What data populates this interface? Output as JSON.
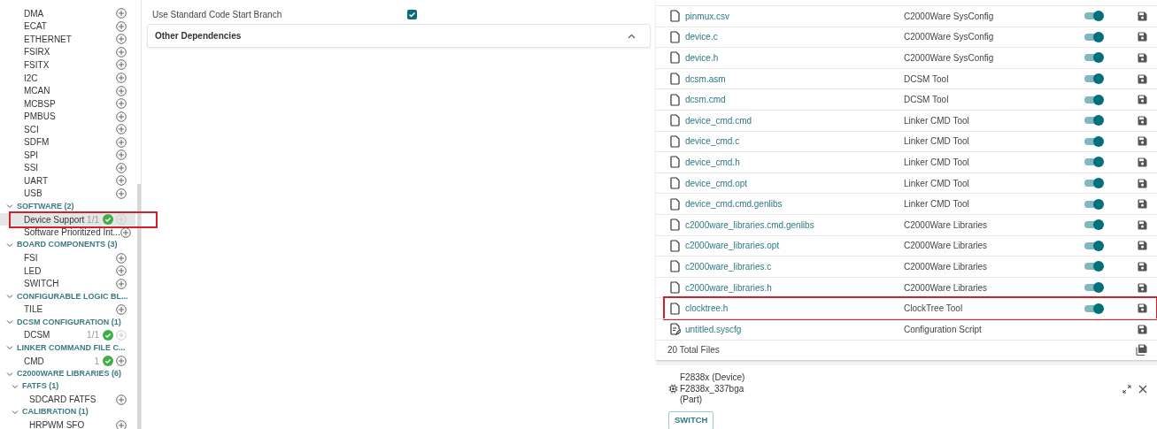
{
  "sidebar": {
    "tree": [
      {
        "label": "DMA",
        "selected": false,
        "add_disabled": false
      },
      {
        "label": "ECAT",
        "selected": false,
        "add_disabled": false
      },
      {
        "label": "ETHERNET",
        "selected": false,
        "add_disabled": false
      },
      {
        "label": "FSIRX",
        "selected": false,
        "add_disabled": false
      },
      {
        "label": "FSITX",
        "selected": false,
        "add_disabled": false
      },
      {
        "label": "I2C",
        "selected": false,
        "add_disabled": false
      },
      {
        "label": "MCAN",
        "selected": false,
        "add_disabled": false
      },
      {
        "label": "MCBSP",
        "selected": false,
        "add_disabled": false
      },
      {
        "label": "PMBUS",
        "selected": false,
        "add_disabled": false
      },
      {
        "label": "SCI",
        "selected": false,
        "add_disabled": false
      },
      {
        "label": "SDFM",
        "selected": false,
        "add_disabled": false
      },
      {
        "label": "SPI",
        "selected": false,
        "add_disabled": false
      },
      {
        "label": "SSI",
        "selected": false,
        "add_disabled": false
      },
      {
        "label": "UART",
        "selected": false,
        "add_disabled": false
      },
      {
        "label": "USB",
        "selected": false,
        "add_disabled": false
      },
      {
        "label": "SOFTWARE (2)",
        "expanded": true,
        "children": [
          {
            "label": "Device Support",
            "count": "1/1",
            "configured": true,
            "selected": true,
            "add_disabled": true,
            "annotated": true
          },
          {
            "label": "Software Prioritized Int...",
            "selected": false,
            "add_disabled": false
          }
        ]
      },
      {
        "label": "BOARD COMPONENTS (3)",
        "expanded": true,
        "children": [
          {
            "label": "FSI",
            "selected": false,
            "add_disabled": false
          },
          {
            "label": "LED",
            "selected": false,
            "add_disabled": false
          },
          {
            "label": "SWITCH",
            "selected": false,
            "add_disabled": false
          }
        ]
      },
      {
        "label": "CONFIGURABLE LOGIC BL...",
        "expanded": true,
        "children": [
          {
            "label": "TILE",
            "selected": false,
            "add_disabled": false
          }
        ]
      },
      {
        "label": "DCSM CONFIGURATION (1)",
        "expanded": true,
        "children": [
          {
            "label": "DCSM",
            "count": "1/1",
            "configured": true,
            "selected": false,
            "add_disabled": true
          }
        ]
      },
      {
        "label": "LINKER COMMAND FILE C...",
        "expanded": true,
        "children": [
          {
            "label": "CMD",
            "count": "1",
            "configured": true,
            "selected": false,
            "add_disabled": false
          }
        ]
      },
      {
        "label": "C2000WARE LIBRARIES (6)",
        "expanded": true,
        "children": [
          {
            "label": "FATFS (1)",
            "expanded": true,
            "children": [
              {
                "label": "SDCARD FATFS",
                "selected": false,
                "add_disabled": false
              }
            ]
          },
          {
            "label": "CALIBRATION (1)",
            "expanded": true,
            "children": [
              {
                "label": "HRPWM SFO",
                "selected": false,
                "add_disabled": false
              }
            ]
          }
        ]
      }
    ]
  },
  "settings": {
    "rows": [
      {
        "label": "Use Standard Code Start Branch",
        "checked": true
      }
    ],
    "sections": [
      {
        "title": "Other Dependencies",
        "expanded": true
      }
    ]
  },
  "files": {
    "rows": [
      {
        "kind": "file",
        "name": "pinmux.csv",
        "source": "C2000Ware SysConfig",
        "on": true
      },
      {
        "kind": "file",
        "name": "device.c",
        "source": "C2000Ware SysConfig",
        "on": true
      },
      {
        "kind": "file",
        "name": "device.h",
        "source": "C2000Ware SysConfig",
        "on": true
      },
      {
        "kind": "file",
        "name": "dcsm.asm",
        "source": "DCSM Tool",
        "on": true
      },
      {
        "kind": "file",
        "name": "dcsm.cmd",
        "source": "DCSM Tool",
        "on": true
      },
      {
        "kind": "file",
        "name": "device_cmd.cmd",
        "source": "Linker CMD Tool",
        "on": true
      },
      {
        "kind": "file",
        "name": "device_cmd.c",
        "source": "Linker CMD Tool",
        "on": true
      },
      {
        "kind": "file",
        "name": "device_cmd.h",
        "source": "Linker CMD Tool",
        "on": true
      },
      {
        "kind": "file",
        "name": "device_cmd.opt",
        "source": "Linker CMD Tool",
        "on": true
      },
      {
        "kind": "file",
        "name": "device_cmd.cmd.genlibs",
        "source": "Linker CMD Tool",
        "on": true
      },
      {
        "kind": "file",
        "name": "c2000ware_libraries.cmd.genlibs",
        "source": "C2000Ware Libraries",
        "on": true
      },
      {
        "kind": "file",
        "name": "c2000ware_libraries.opt",
        "source": "C2000Ware Libraries",
        "on": true
      },
      {
        "kind": "file",
        "name": "c2000ware_libraries.c",
        "source": "C2000Ware Libraries",
        "on": true
      },
      {
        "kind": "file",
        "name": "c2000ware_libraries.h",
        "source": "C2000Ware Libraries",
        "on": true
      },
      {
        "kind": "file",
        "name": "clocktree.h",
        "source": "ClockTree Tool",
        "on": true,
        "annotated": true
      },
      {
        "kind": "script",
        "name": "untitled.syscfg",
        "source": "Configuration Script"
      }
    ],
    "total": "20 Total Files"
  },
  "device": {
    "lines": [
      "F2838x (Device)",
      "F2838x_337bga",
      "(Part)"
    ],
    "button": "SWITCH"
  }
}
